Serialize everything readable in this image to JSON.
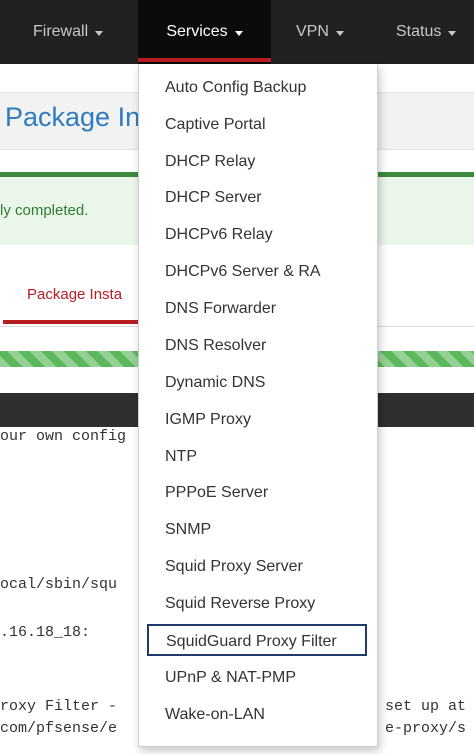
{
  "navbar": {
    "items": [
      {
        "label": "Firewall"
      },
      {
        "label": "Services"
      },
      {
        "label": "VPN"
      },
      {
        "label": "Status"
      }
    ],
    "active": "Services",
    "active_accent": "#b61d22"
  },
  "page": {
    "title": "Package In",
    "alert_text": "ly completed.",
    "tab_label": "Package Insta",
    "progress_percent": 100,
    "console_lines": [
      "our own config",
      "ocal/sbin/squ",
      ".16.18_18:",
      "roxy Filter -",
      "com/pfsense/e",
      "set up at",
      "e-proxy/s"
    ]
  },
  "services_menu": {
    "items": [
      "Auto Config Backup",
      "Captive Portal",
      "DHCP Relay",
      "DHCP Server",
      "DHCPv6 Relay",
      "DHCPv6 Server & RA",
      "DNS Forwarder",
      "DNS Resolver",
      "Dynamic DNS",
      "IGMP Proxy",
      "NTP",
      "PPPoE Server",
      "SNMP",
      "Squid Proxy Server",
      "Squid Reverse Proxy",
      "SquidGuard Proxy Filter",
      "UPnP & NAT-PMP",
      "Wake-on-LAN"
    ],
    "highlighted": "SquidGuard Proxy Filter",
    "highlight_color": "#203a6b"
  }
}
